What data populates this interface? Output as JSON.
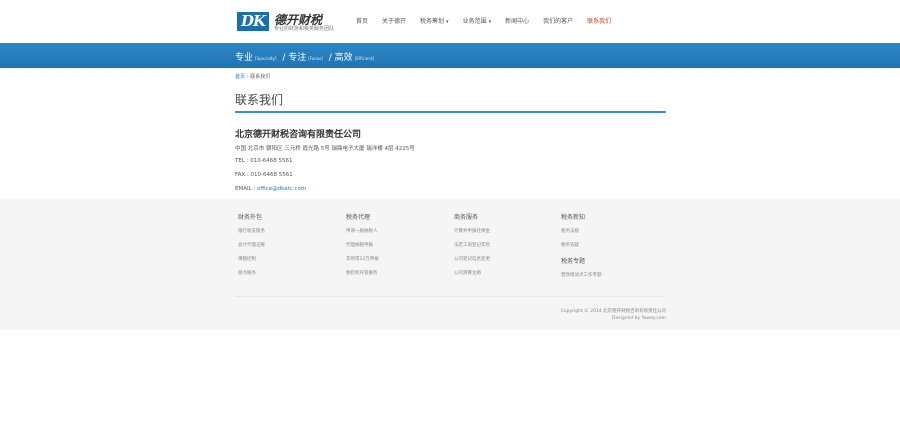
{
  "header": {
    "logo_mark": "DK",
    "logo_name": "德开财税",
    "logo_tagline": "专业的财务和税务服务团队",
    "nav": [
      {
        "label": "首页",
        "caret": false
      },
      {
        "label": "关于德开",
        "caret": false
      },
      {
        "label": "税务筹划",
        "caret": true
      },
      {
        "label": "业务范围",
        "caret": true
      },
      {
        "label": "新闻中心",
        "caret": false
      },
      {
        "label": "我们的客户",
        "caret": false
      },
      {
        "label": "联系我们",
        "caret": false,
        "active": true
      }
    ]
  },
  "banner": {
    "w1": "专业",
    "e1": "[Specialty]",
    "w2": "专注",
    "e2": "[Focus]",
    "w3": "高效",
    "e3": "[Efficient]",
    "sep": "/"
  },
  "breadcrumb": {
    "home": "首页",
    "sep": "›",
    "current": "联系我们"
  },
  "page_title": "联系我们",
  "contact": {
    "company": "北京德开财税咨询有限责任公司",
    "address": "中国 北京市 朝阳区 三元桥 霞光路 5号 瑞鼎电子大厦 瑞洋楼 4层 4225号",
    "tel": "TEL : 010-6468 5561",
    "fax": "FAX : 010-6468 5561",
    "email_label": "EMAIL : ",
    "email": "office@dkatc.com"
  },
  "footer": {
    "col1": {
      "title": "财务外包",
      "links": [
        "银行收支服务",
        "会计代理记账",
        "薄额控制",
        "盘点服务"
      ]
    },
    "col2": {
      "title": "税务代理",
      "links": [
        "申请一般纳税人",
        "代理纳税申报",
        "年所得12万申报",
        "税控机托管服务"
      ]
    },
    "col3": {
      "title": "商务服务",
      "links": [
        "计算并申报社保金",
        "法定工商登记年检",
        "公司登记信息变更",
        "公司清算注销"
      ]
    },
    "col4": {
      "title": "税务新知",
      "links": [
        "税务法规",
        "税务答疑"
      ],
      "title2": "税务专题",
      "links2": [
        "营改增试点工作专题"
      ]
    },
    "copyright": "Copyright  © 2014 北京德开财税咨询有限责任公司",
    "designed": "Designed by Yoway.com"
  }
}
